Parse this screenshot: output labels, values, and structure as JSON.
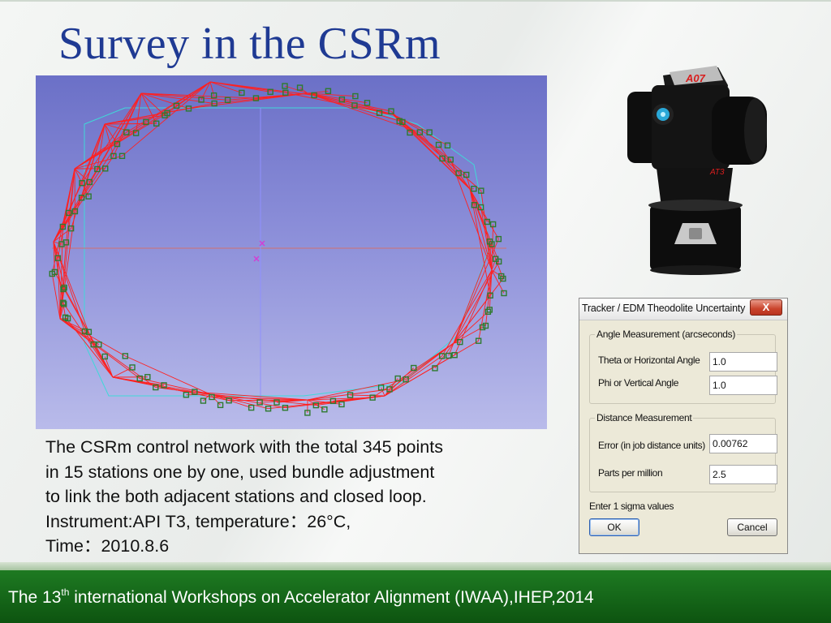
{
  "slide": {
    "title": "Survey in the CSRm",
    "caption_lines": [
      "The CSRm control network with the total 345 points",
      "in 15 stations one by one, used bundle adjustment",
      "to link the both adjacent stations and closed loop.",
      "Instrument:API T3,  temperature：26°C,",
      "Time：2010.8.6"
    ]
  },
  "network_view": {
    "background_top": "#6b70c7",
    "line_color": "#ff2020",
    "point_color": "#2f7a2f",
    "marker_color": "#d43cd4",
    "icons": [
      "network-point-icon",
      "origin-cross-icon"
    ]
  },
  "tracker": {
    "brand_text": "A07",
    "side_text": "AT3",
    "colors": {
      "body": "#111111",
      "lens": "#2aa8d8",
      "silver": "#bfbfbf",
      "brand": "#d81e1e"
    }
  },
  "dialog": {
    "title": "Tracker / EDM Theodolite Uncertainty",
    "close_label": "X",
    "angle_group": {
      "legend": "Angle Measurement (arcseconds)",
      "theta_label": "Theta or Horizontal Angle",
      "theta_value": "1.0",
      "phi_label": "Phi or Vertical Angle",
      "phi_value": "1.0"
    },
    "distance_group": {
      "legend": "Distance Measurement",
      "error_label": "Error (in job distance units)",
      "error_value": "0.00762",
      "ppm_label": "Parts per million",
      "ppm_value": "2.5"
    },
    "hint": "Enter 1 sigma values",
    "ok_label": "OK",
    "cancel_label": "Cancel"
  },
  "footer": {
    "prefix": "The 13",
    "superscript": "th",
    "suffix": " international Workshops on Accelerator Alignment (IWAA),IHEP,2014",
    "color": "#1e7a22"
  }
}
